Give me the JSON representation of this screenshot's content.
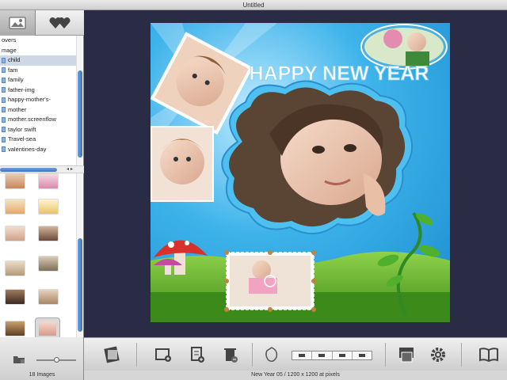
{
  "window": {
    "title": "Untitled"
  },
  "sidebar": {
    "folders": [
      {
        "label": "overs"
      },
      {
        "label": "mage"
      },
      {
        "label": "child",
        "selected": true
      },
      {
        "label": "fam"
      },
      {
        "label": "family"
      },
      {
        "label": "father-img"
      },
      {
        "label": "happy-mother's-"
      },
      {
        "label": "mother"
      },
      {
        "label": "mother.screenflow"
      },
      {
        "label": "taylor swift"
      },
      {
        "label": "Travel-sea"
      },
      {
        "label": "valentines-day"
      }
    ],
    "image_count": "18 Images"
  },
  "card": {
    "headline": "HAPPY NEW YEAR"
  },
  "status": {
    "text": "New Year 05 / 1200 x 1200 at pixels"
  },
  "colors": {
    "canvas_bg": "#2a2b45",
    "sky": "#3db3ea",
    "headline": "#ffffff",
    "grass": "#5aa82e"
  },
  "icons": [
    "photos-tab-icon",
    "favorites-tab-icon",
    "folder-icon",
    "zoom-slider",
    "collage-icon",
    "add-frame-icon",
    "add-page-icon",
    "delete-icon",
    "shape-icon",
    "align-buttons",
    "cards-icon",
    "settings-icon",
    "book-icon"
  ]
}
